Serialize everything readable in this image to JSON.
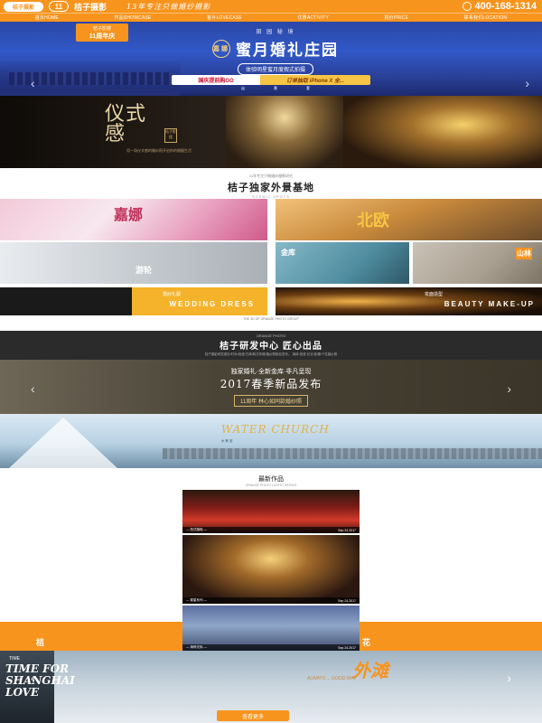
{
  "header": {
    "logo_text": "桔子摄影",
    "badge_number": "11",
    "brand": "桔子摄影",
    "slogan": "13年专注只做婚纱摄影",
    "phone": "400-168-1314"
  },
  "nav": {
    "items": [
      "首页HOME",
      "作品SHOWCASE",
      "客片LOVECASE",
      "优惠ACTIVITY",
      "报价PRICE",
      "联系我们LOCATION"
    ]
  },
  "hero": {
    "badge_top": "桔子影楼",
    "badge_main": "11周年庆",
    "subtitle_top": "田 园 秘 境",
    "mini_logo": "嘉娜",
    "title": "蜜月婚礼庄园",
    "tagline": "体验明星蜜月度假式拍摄",
    "stats": [
      {
        "value": "200",
        "label": "亩"
      },
      {
        "value": "300",
        "label": "景"
      },
      {
        "value": "1000",
        "label": "套"
      }
    ],
    "promo_left": "国庆提前购GO",
    "promo_right": "订单抽取 iPhone X 全...",
    "arrow_left": "‹",
    "arrow_right": "›"
  },
  "ritual": {
    "title_line1": "仪式",
    "title_line2": "感",
    "seal": "桔子影楼",
    "text": "用一场仪式感的婚纱照开启你的婚姻生活"
  },
  "scenic": {
    "tiny": "11年专注只做婚纱摄影研究",
    "title": "桔子独家外景基地",
    "english": "SCENIC SPOTS",
    "tiles": {
      "t1": "嘉娜",
      "t2": "北欧",
      "t3": "游轮",
      "t4": "金库",
      "t5": "山林",
      "wedding_cn": "婚纱礼服",
      "wedding_en": "WEDDING DRESS",
      "beauty_cn": "妆面造型",
      "beauty_en": "BEAUTY MAKE-UP"
    },
    "footnote": "THE 3D OF ORANGE PHOTO GROUP"
  },
  "rd": {
    "english": "ORANGE PHOTO",
    "title": "桔子研发中心 匠心出品",
    "desc": "桔子摄影研发团队/时尚/浪漫/古典/韩式风格/婚纱照新品发布。 演绎·浪漫·纪实/影棚/个性婚纱照"
  },
  "spring": {
    "line1": "独家婚礼·全新金库·非凡呈现",
    "line2": "2017春季新品发布",
    "line3": "11周年 林心如同款婚纱照"
  },
  "church": {
    "title": "WATER CHURCH",
    "subtitle": "水 教 堂"
  },
  "latest": {
    "title": "最新作品",
    "english": "ORANGE PHOTO LATEST WORKS",
    "works": [
      {
        "name": "— 西式旗袍 —",
        "date": "Sep.24.2017"
      },
      {
        "name": "— 繁星系列 —",
        "date": "Sep.24.2017"
      },
      {
        "name": "— 海岸天际 —",
        "date": "Sep.24.2017"
      }
    ]
  },
  "orange_band": {
    "left": "桔",
    "right": "花"
  },
  "shanghai": {
    "small": "TIME",
    "title_line1": "TIME FOR",
    "title_line2": "SHANGHAI",
    "title_line3": "LOVE",
    "waitan": "外滩",
    "waitan_sub": "ALWAYS ... GOOD WAY",
    "button": "查看更多",
    "arrow_left": "‹",
    "arrow_right": "›"
  },
  "colors": {
    "brand_orange": "#f7941d",
    "hero_blue": "#2b47a5",
    "dark_band": "#2b2b2b"
  }
}
